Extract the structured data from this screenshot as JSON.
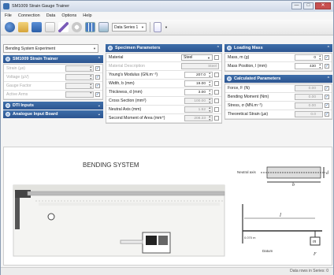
{
  "window": {
    "title": "SM1009 Strain Gauge Trainer",
    "minimize": "—",
    "maximize": "□",
    "close": "✕"
  },
  "menu": [
    "File",
    "Connection",
    "Data",
    "Options",
    "Help"
  ],
  "toolbar": {
    "data_series": "Data Series 1"
  },
  "experiment_select": "Bending System Experiment",
  "trainer": {
    "title": "SM1009 Strain Trainer",
    "rows": [
      {
        "label": "Strain  (µs)"
      },
      {
        "label": "Voltage  (µV)"
      },
      {
        "label": "Gauge Factor"
      },
      {
        "label": "Active Arms"
      }
    ]
  },
  "dti": {
    "title": "DTI Inputs"
  },
  "analogue": {
    "title": "Analogue Input Board"
  },
  "specimen": {
    "title": "Specimen Parameters",
    "material_label": "Material",
    "material_value": "Steel",
    "material_desc_label": "Material Description",
    "material_desc_value": "Steel",
    "rows": [
      {
        "label": "Young's Modulus  (GN.m⁻²)",
        "value": "207.0"
      },
      {
        "label": "Width, b  (mm)",
        "value": "19.00"
      },
      {
        "label": "Thickness, d  (mm)",
        "value": "3.00"
      },
      {
        "label": "Cross Section  (mm²)",
        "value": "100.00"
      },
      {
        "label": "Neutral Axis  (mm)",
        "value": "1.52"
      },
      {
        "label": "Second Moment of Area  (mm⁴)",
        "value": "208.33"
      }
    ]
  },
  "loading": {
    "title": "Loading Mass",
    "rows": [
      {
        "label": "Mass, m  (g)",
        "value": "0"
      },
      {
        "label": "Mass Position, l  (mm)",
        "value": "430"
      }
    ]
  },
  "calculated": {
    "title": "Calculated Parameters",
    "rows": [
      {
        "label": "Force, F  (N)",
        "value": "0.00"
      },
      {
        "label": "Bending Moment  (Nm)",
        "value": "0.00"
      },
      {
        "label": "Stress, σ  (MN.m⁻²)",
        "value": "0.00"
      },
      {
        "label": "Theoretical Strain  (µs)",
        "value": "0.0"
      }
    ]
  },
  "diagram": {
    "title": "BENDING SYSTEM",
    "neutral_axis": "Neutral axis",
    "dim_d": "d",
    "dim_b": "b",
    "dim_l": "l",
    "dim_small": "0.070 m",
    "mass": "m",
    "force": "F",
    "datum": "Datum"
  },
  "status": "Data rows in Series: 0"
}
